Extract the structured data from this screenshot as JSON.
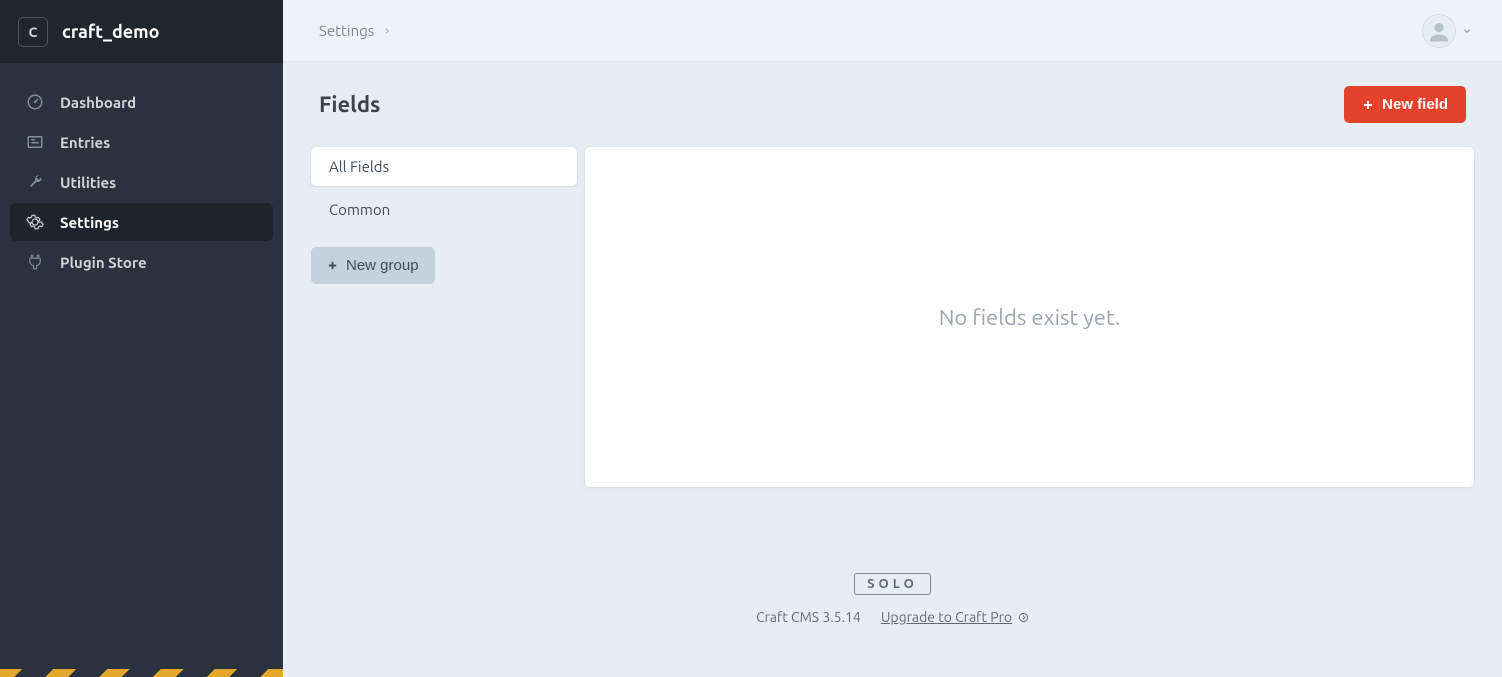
{
  "site": {
    "logo_letter": "C",
    "name": "craft_demo"
  },
  "nav": {
    "items": [
      {
        "label": "Dashboard",
        "icon": "gauge-icon",
        "active": false
      },
      {
        "label": "Entries",
        "icon": "news-icon",
        "active": false
      },
      {
        "label": "Utilities",
        "icon": "wrench-icon",
        "active": false
      },
      {
        "label": "Settings",
        "icon": "gear-icon",
        "active": true
      },
      {
        "label": "Plugin Store",
        "icon": "plug-icon",
        "active": false
      }
    ]
  },
  "breadcrumbs": {
    "items": [
      "Settings"
    ]
  },
  "page": {
    "title": "Fields",
    "new_field_label": "New field"
  },
  "groups": {
    "items": [
      {
        "label": "All Fields",
        "selected": true
      },
      {
        "label": "Common",
        "selected": false
      }
    ],
    "new_group_label": "New group"
  },
  "fields_panel": {
    "empty_message": "No fields exist yet."
  },
  "footer": {
    "edition": "SOLO",
    "version": "Craft CMS 3.5.14",
    "upgrade_label": "Upgrade to Craft Pro"
  }
}
